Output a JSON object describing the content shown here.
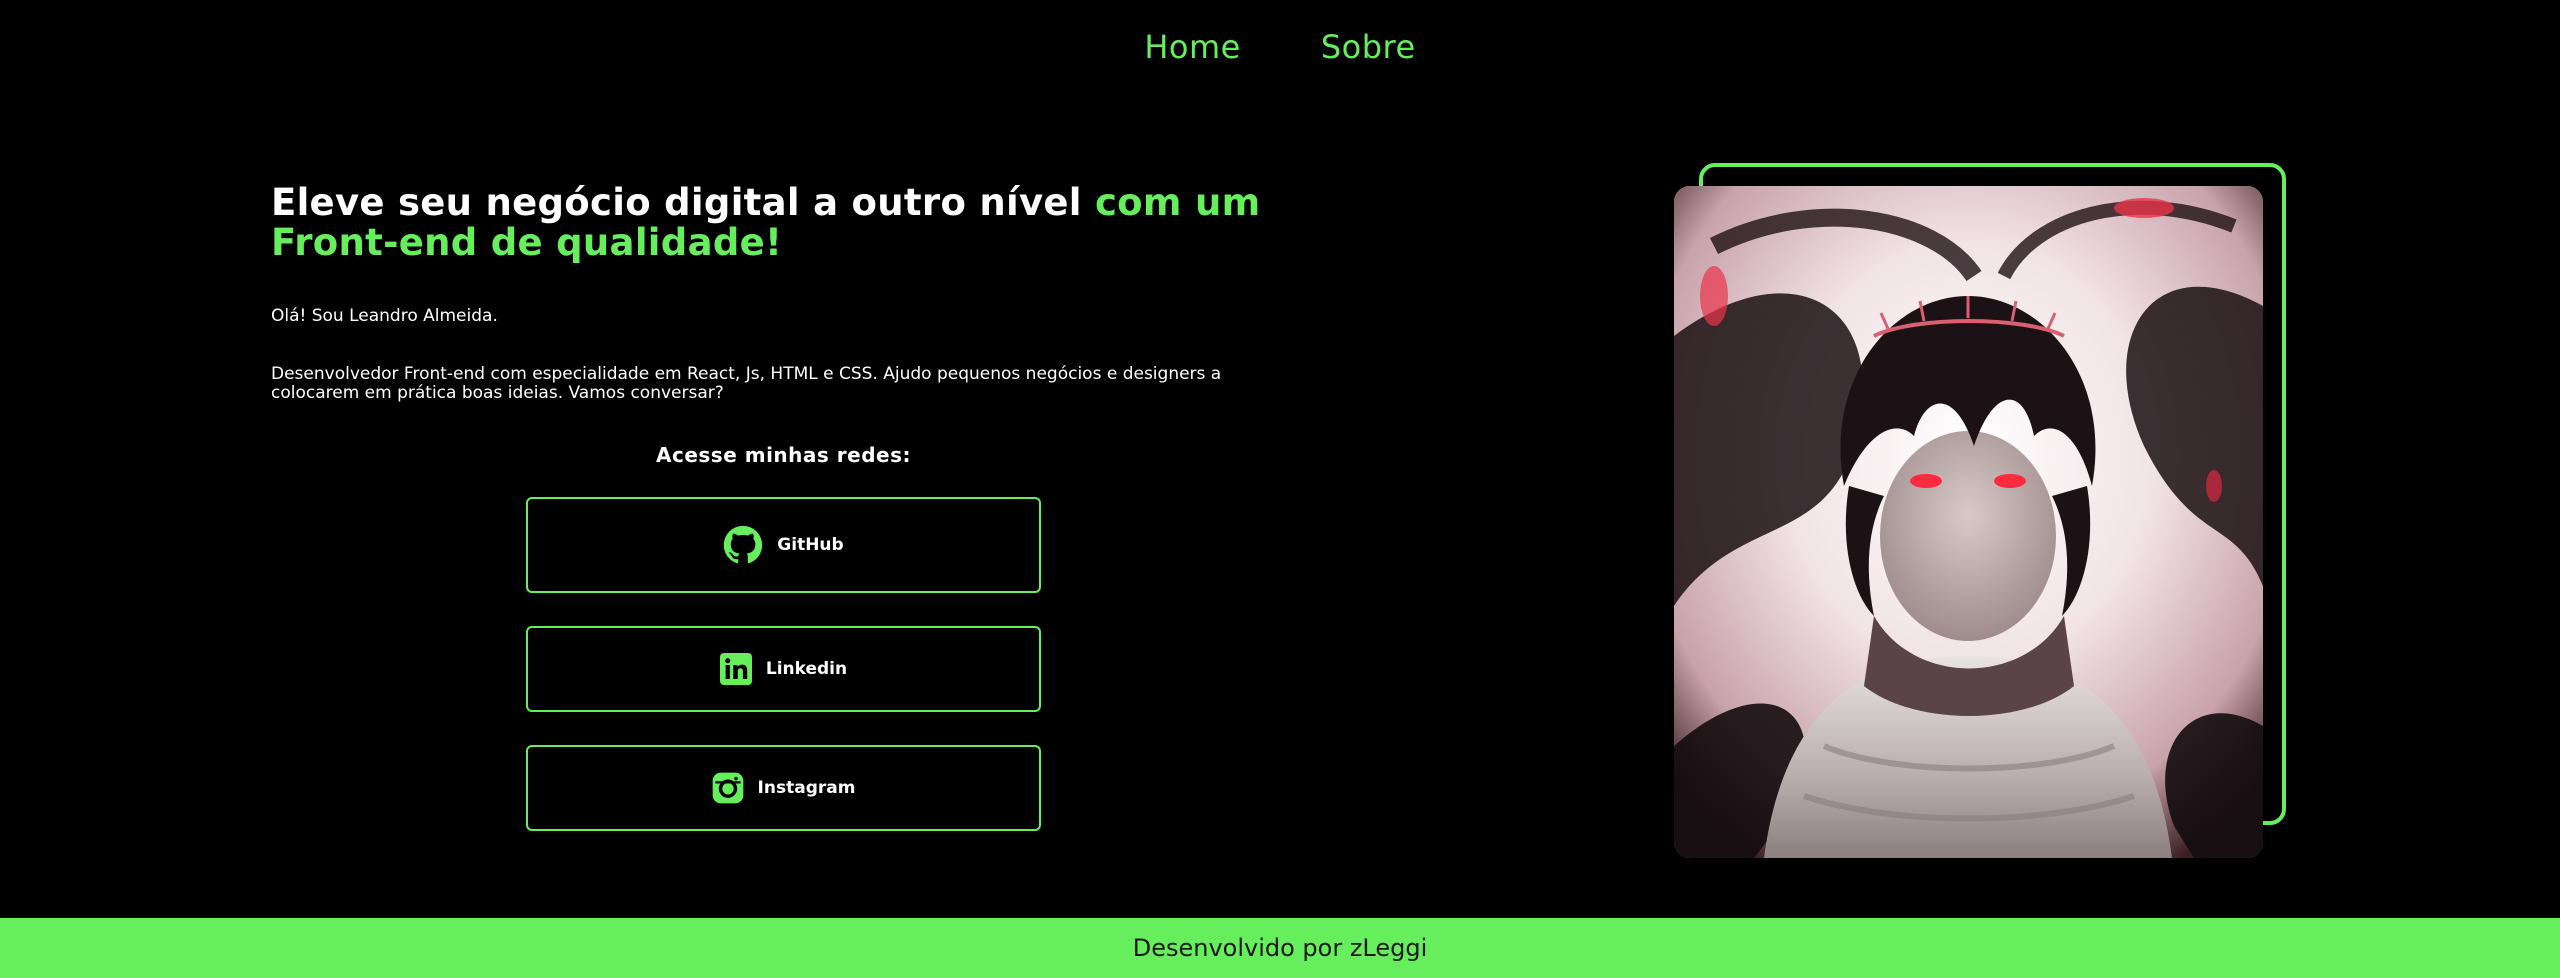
{
  "nav": {
    "items": [
      {
        "label": "Home"
      },
      {
        "label": "Sobre"
      }
    ]
  },
  "hero": {
    "title_white": "Eleve seu negócio digital a outro nível ",
    "title_accent": "com um Front-end de qualidade!",
    "greeting": "Olá! Sou Leandro Almeida.",
    "description": "Desenvolvedor Front-end com especialidade em React, Js, HTML e CSS. Ajudo pequenos negócios e designers a colocarem em prática boas ideias. Vamos conversar?",
    "networks_title": "Acesse minhas redes:"
  },
  "social": [
    {
      "label": "GitHub",
      "icon": "github-icon"
    },
    {
      "label": "Linkedin",
      "icon": "linkedin-icon"
    },
    {
      "label": "Instagram",
      "icon": "instagram-icon"
    }
  ],
  "portrait": {
    "description_icon": "anime-portrait-image"
  },
  "footer": {
    "text": "Desenvolvido por zLeggi"
  },
  "colors": {
    "background": "#000000",
    "accent": "#66ee5c",
    "text": "#ffffff",
    "footer_text": "#1a1a1a"
  }
}
